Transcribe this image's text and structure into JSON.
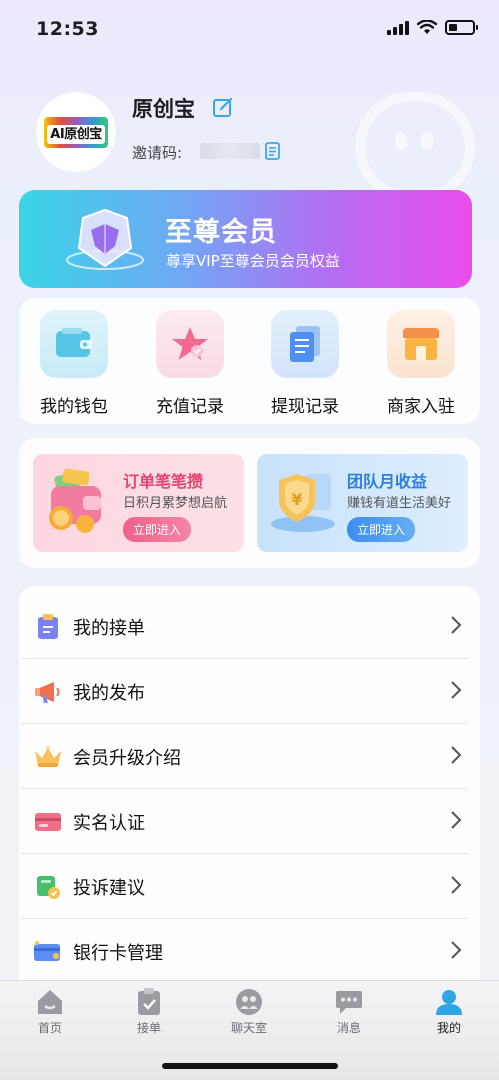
{
  "status_bar": {
    "time": "12:53"
  },
  "profile": {
    "avatar_text": "AI原创宝",
    "username": "原创宝",
    "invite_label": "邀请码:",
    "invite_value": "••••••"
  },
  "vip": {
    "title": "至尊会员",
    "subtitle": "尊享VIP至尊会员会员权益"
  },
  "quick_actions": [
    {
      "label": "我的钱包",
      "icon": "wallet-icon"
    },
    {
      "label": "充值记录",
      "icon": "star-icon"
    },
    {
      "label": "提现记录",
      "icon": "document-icon"
    },
    {
      "label": "商家入驻",
      "icon": "store-icon"
    }
  ],
  "promos": [
    {
      "title": "订单笔笔攒",
      "subtitle": "日积月累梦想启航",
      "button": "立即进入",
      "icon": "wallet-coins-icon"
    },
    {
      "title": "团队月收益",
      "subtitle": "赚钱有道生活美好",
      "button": "立即进入",
      "icon": "shield-yuan-icon"
    }
  ],
  "menu": [
    {
      "label": "我的接单",
      "icon": "clipboard-icon"
    },
    {
      "label": "我的发布",
      "icon": "megaphone-icon"
    },
    {
      "label": "会员升级介绍",
      "icon": "crown-icon"
    },
    {
      "label": "实名认证",
      "icon": "id-card-icon"
    },
    {
      "label": "投诉建议",
      "icon": "feedback-icon"
    },
    {
      "label": "银行卡管理",
      "icon": "bank-card-icon"
    }
  ],
  "tabs": [
    {
      "label": "首页",
      "icon": "home-icon",
      "active": false
    },
    {
      "label": "接单",
      "icon": "clipboard-check-icon",
      "active": false
    },
    {
      "label": "聊天室",
      "icon": "chat-room-icon",
      "active": false
    },
    {
      "label": "消息",
      "icon": "message-icon",
      "active": false
    },
    {
      "label": "我的",
      "icon": "user-icon",
      "active": true
    }
  ],
  "colors": {
    "vip_gradient_start": "#39d5e6",
    "vip_gradient_end": "#ea4cea",
    "promo_pink": "#e8456e",
    "promo_blue": "#2c7fe0",
    "active_tab": "#2ea6e6"
  }
}
